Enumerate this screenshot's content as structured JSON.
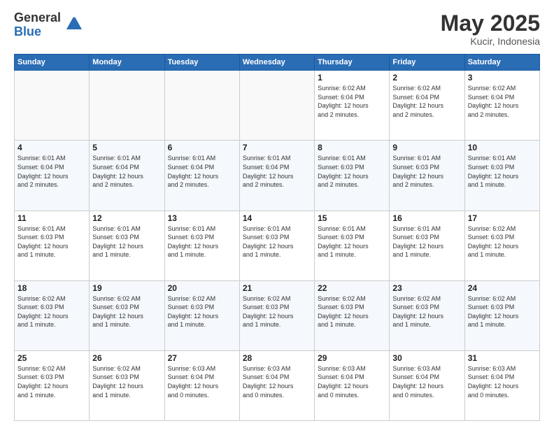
{
  "logo": {
    "general": "General",
    "blue": "Blue"
  },
  "header": {
    "month": "May 2025",
    "location": "Kucir, Indonesia"
  },
  "weekdays": [
    "Sunday",
    "Monday",
    "Tuesday",
    "Wednesday",
    "Thursday",
    "Friday",
    "Saturday"
  ],
  "weeks": [
    [
      {
        "day": "",
        "info": ""
      },
      {
        "day": "",
        "info": ""
      },
      {
        "day": "",
        "info": ""
      },
      {
        "day": "",
        "info": ""
      },
      {
        "day": "1",
        "info": "Sunrise: 6:02 AM\nSunset: 6:04 PM\nDaylight: 12 hours\nand 2 minutes."
      },
      {
        "day": "2",
        "info": "Sunrise: 6:02 AM\nSunset: 6:04 PM\nDaylight: 12 hours\nand 2 minutes."
      },
      {
        "day": "3",
        "info": "Sunrise: 6:02 AM\nSunset: 6:04 PM\nDaylight: 12 hours\nand 2 minutes."
      }
    ],
    [
      {
        "day": "4",
        "info": "Sunrise: 6:01 AM\nSunset: 6:04 PM\nDaylight: 12 hours\nand 2 minutes."
      },
      {
        "day": "5",
        "info": "Sunrise: 6:01 AM\nSunset: 6:04 PM\nDaylight: 12 hours\nand 2 minutes."
      },
      {
        "day": "6",
        "info": "Sunrise: 6:01 AM\nSunset: 6:04 PM\nDaylight: 12 hours\nand 2 minutes."
      },
      {
        "day": "7",
        "info": "Sunrise: 6:01 AM\nSunset: 6:04 PM\nDaylight: 12 hours\nand 2 minutes."
      },
      {
        "day": "8",
        "info": "Sunrise: 6:01 AM\nSunset: 6:03 PM\nDaylight: 12 hours\nand 2 minutes."
      },
      {
        "day": "9",
        "info": "Sunrise: 6:01 AM\nSunset: 6:03 PM\nDaylight: 12 hours\nand 2 minutes."
      },
      {
        "day": "10",
        "info": "Sunrise: 6:01 AM\nSunset: 6:03 PM\nDaylight: 12 hours\nand 1 minute."
      }
    ],
    [
      {
        "day": "11",
        "info": "Sunrise: 6:01 AM\nSunset: 6:03 PM\nDaylight: 12 hours\nand 1 minute."
      },
      {
        "day": "12",
        "info": "Sunrise: 6:01 AM\nSunset: 6:03 PM\nDaylight: 12 hours\nand 1 minute."
      },
      {
        "day": "13",
        "info": "Sunrise: 6:01 AM\nSunset: 6:03 PM\nDaylight: 12 hours\nand 1 minute."
      },
      {
        "day": "14",
        "info": "Sunrise: 6:01 AM\nSunset: 6:03 PM\nDaylight: 12 hours\nand 1 minute."
      },
      {
        "day": "15",
        "info": "Sunrise: 6:01 AM\nSunset: 6:03 PM\nDaylight: 12 hours\nand 1 minute."
      },
      {
        "day": "16",
        "info": "Sunrise: 6:01 AM\nSunset: 6:03 PM\nDaylight: 12 hours\nand 1 minute."
      },
      {
        "day": "17",
        "info": "Sunrise: 6:02 AM\nSunset: 6:03 PM\nDaylight: 12 hours\nand 1 minute."
      }
    ],
    [
      {
        "day": "18",
        "info": "Sunrise: 6:02 AM\nSunset: 6:03 PM\nDaylight: 12 hours\nand 1 minute."
      },
      {
        "day": "19",
        "info": "Sunrise: 6:02 AM\nSunset: 6:03 PM\nDaylight: 12 hours\nand 1 minute."
      },
      {
        "day": "20",
        "info": "Sunrise: 6:02 AM\nSunset: 6:03 PM\nDaylight: 12 hours\nand 1 minute."
      },
      {
        "day": "21",
        "info": "Sunrise: 6:02 AM\nSunset: 6:03 PM\nDaylight: 12 hours\nand 1 minute."
      },
      {
        "day": "22",
        "info": "Sunrise: 6:02 AM\nSunset: 6:03 PM\nDaylight: 12 hours\nand 1 minute."
      },
      {
        "day": "23",
        "info": "Sunrise: 6:02 AM\nSunset: 6:03 PM\nDaylight: 12 hours\nand 1 minute."
      },
      {
        "day": "24",
        "info": "Sunrise: 6:02 AM\nSunset: 6:03 PM\nDaylight: 12 hours\nand 1 minute."
      }
    ],
    [
      {
        "day": "25",
        "info": "Sunrise: 6:02 AM\nSunset: 6:03 PM\nDaylight: 12 hours\nand 1 minute."
      },
      {
        "day": "26",
        "info": "Sunrise: 6:02 AM\nSunset: 6:03 PM\nDaylight: 12 hours\nand 1 minute."
      },
      {
        "day": "27",
        "info": "Sunrise: 6:03 AM\nSunset: 6:04 PM\nDaylight: 12 hours\nand 0 minutes."
      },
      {
        "day": "28",
        "info": "Sunrise: 6:03 AM\nSunset: 6:04 PM\nDaylight: 12 hours\nand 0 minutes."
      },
      {
        "day": "29",
        "info": "Sunrise: 6:03 AM\nSunset: 6:04 PM\nDaylight: 12 hours\nand 0 minutes."
      },
      {
        "day": "30",
        "info": "Sunrise: 6:03 AM\nSunset: 6:04 PM\nDaylight: 12 hours\nand 0 minutes."
      },
      {
        "day": "31",
        "info": "Sunrise: 6:03 AM\nSunset: 6:04 PM\nDaylight: 12 hours\nand 0 minutes."
      }
    ]
  ]
}
